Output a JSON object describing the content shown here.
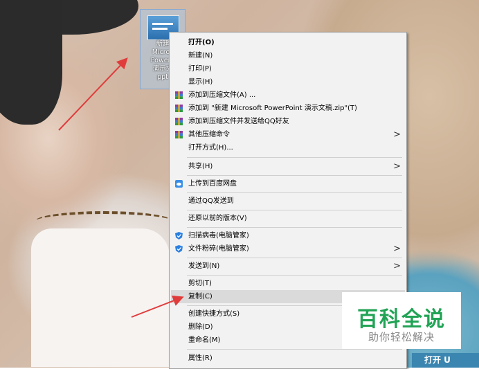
{
  "desktop": {
    "file_label": "新建\nMicros\nPowerP\n演示文\nppt"
  },
  "menu": {
    "items": [
      {
        "label": "打开(O)",
        "bold": true
      },
      {
        "label": "新建(N)"
      },
      {
        "label": "打印(P)"
      },
      {
        "label": "显示(H)"
      },
      {
        "label": "添加到压缩文件(A) ...",
        "icon": "winrar-icon"
      },
      {
        "label": "添加到 \"新建 Microsoft PowerPoint 演示文稿.zip\"(T)",
        "icon": "winrar-icon"
      },
      {
        "label": "添加到压缩文件并发送给QQ好友",
        "icon": "winrar-icon"
      },
      {
        "label": "其他压缩命令",
        "icon": "winrar-icon",
        "submenu": true
      },
      {
        "label": "打开方式(H)..."
      },
      {
        "label": "共享(H)",
        "submenu": true
      },
      {
        "label": "上传到百度网盘",
        "icon": "baidu-netdisk-icon"
      },
      {
        "label": "通过QQ发送到"
      },
      {
        "label": "还原以前的版本(V)"
      },
      {
        "label": "扫描病毒(电脑管家)",
        "icon": "tencent-pcmgr-icon"
      },
      {
        "label": "文件粉碎(电脑管家)",
        "icon": "tencent-pcmgr-icon",
        "submenu": true
      },
      {
        "label": "发送到(N)",
        "submenu": true
      },
      {
        "label": "剪切(T)"
      },
      {
        "label": "复制(C)",
        "highlighted": true
      },
      {
        "label": "创建快捷方式(S)"
      },
      {
        "label": "删除(D)"
      },
      {
        "label": "重命名(M)"
      },
      {
        "label": "属性(R)"
      }
    ]
  },
  "watermark": {
    "title": "百科全说",
    "subtitle": "助你轻松解决"
  },
  "corner_button": "打开 U",
  "colors": {
    "menu_bg": "#f2f2f2",
    "highlight": "#dadada",
    "annotation_arrow": "#e03c3c",
    "watermark_green": "#21a355"
  }
}
